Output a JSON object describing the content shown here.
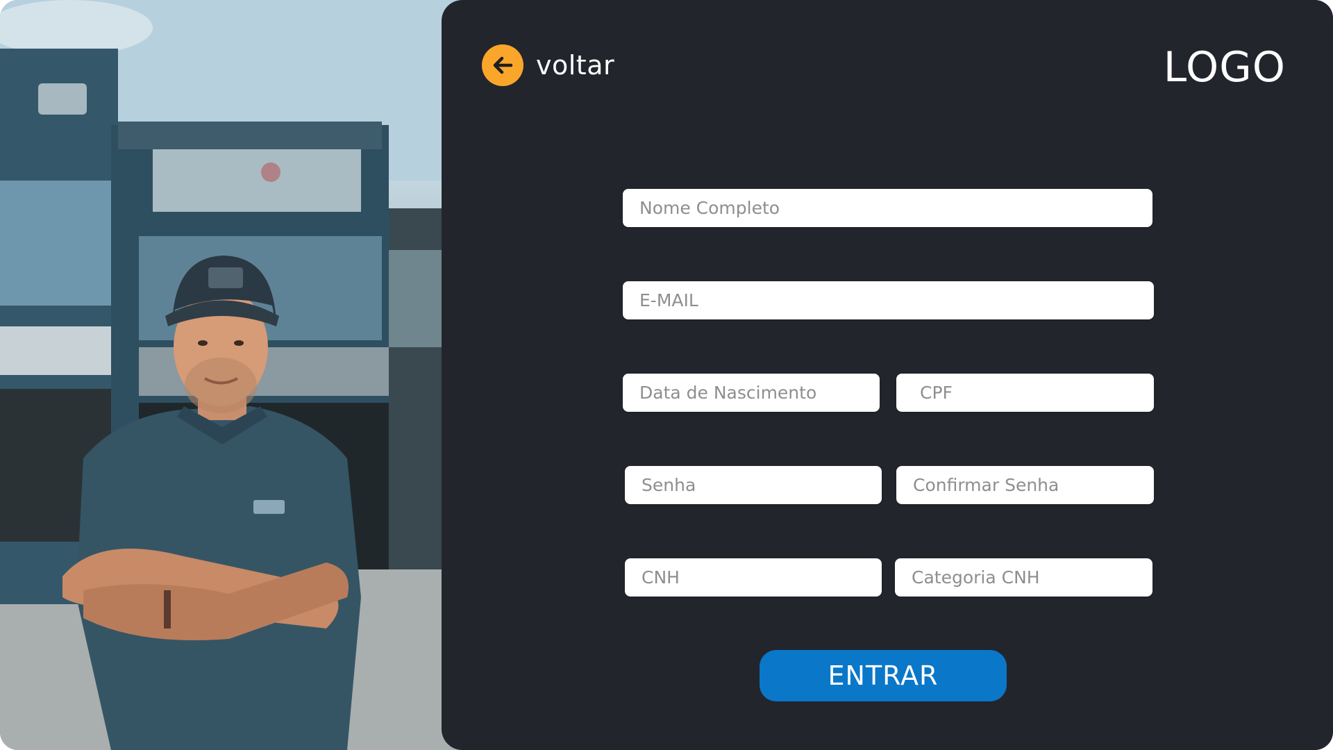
{
  "header": {
    "back_label": "voltar",
    "logo_text": "LOGO"
  },
  "form": {
    "full_name": {
      "placeholder": "Nome Completo",
      "value": ""
    },
    "email": {
      "placeholder": "E-MAIL",
      "value": ""
    },
    "birth_date": {
      "placeholder": "Data de Nascimento",
      "value": ""
    },
    "cpf": {
      "placeholder": "CPF",
      "value": ""
    },
    "password": {
      "placeholder": "Senha",
      "value": ""
    },
    "confirm_password": {
      "placeholder": "Confirmar Senha",
      "value": ""
    },
    "cnh": {
      "placeholder": "CNH",
      "value": ""
    },
    "cnh_category": {
      "placeholder": "Categoria CNH",
      "value": ""
    },
    "submit_label": "ENTRAR"
  },
  "colors": {
    "panel_background": "#23252d",
    "back_button": "#f9a62b",
    "submit_button": "#0a77c9",
    "input_background": "#ffffff"
  },
  "icons": {
    "back": "arrow-left-icon"
  },
  "image": {
    "description_name": "truck-driver-photo"
  }
}
